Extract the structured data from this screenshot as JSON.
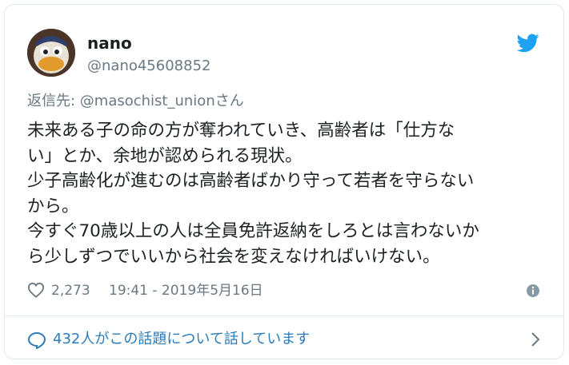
{
  "author": {
    "display_name": "nano",
    "handle": "@nano45608852"
  },
  "reply": {
    "prefix": "返信先: ",
    "mention": "@masochist_union",
    "suffix": "さん"
  },
  "tweet": {
    "lines": [
      "未来ある子の命の方が奪われていき、高齢者は「仕方な",
      "い」とか、余地が認められる現状。",
      "少子高齢化が進むのは高齢者ばかり守って若者を守らない",
      "から。",
      "今すぐ70歳以上の人は全員免許返納をしろとは言わないか",
      "ら少しずつでいいから社会を変えなければいけない。"
    ]
  },
  "meta": {
    "likes": "2,273",
    "timestamp": "19:41 - 2019年5月16日"
  },
  "footer": {
    "talk_label": "432人がこの話題について話しています"
  },
  "icons": {
    "bird": "twitter-bird-icon",
    "heart": "heart-icon",
    "info": "info-icon",
    "bubble": "speech-bubble-icon",
    "chevron": "chevron-right-icon"
  },
  "colors": {
    "twitter_blue": "#1da1f2",
    "link_blue": "#2b7bb9",
    "muted": "#697882",
    "text": "#1c2022",
    "border": "#e1e8ed"
  }
}
